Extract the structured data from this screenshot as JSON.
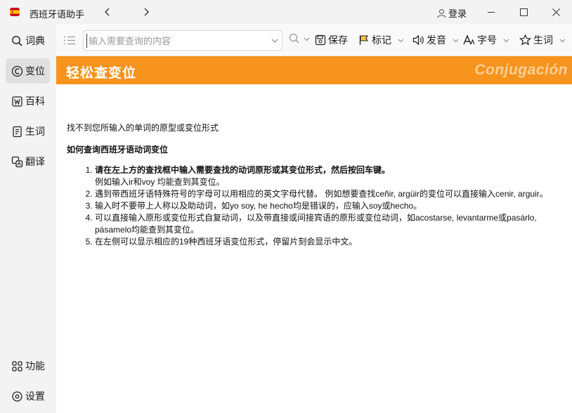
{
  "window": {
    "title": "西班牙语助手",
    "login_label": "登录"
  },
  "sidebar": {
    "items": [
      {
        "label": "词典",
        "icon": "search-icon"
      },
      {
        "label": "变位",
        "icon": "conjugation-icon",
        "active": true
      },
      {
        "label": "百科",
        "icon": "encyclopedia-icon"
      },
      {
        "label": "生词",
        "icon": "notebook-icon"
      },
      {
        "label": "翻译",
        "icon": "translate-icon"
      }
    ],
    "bottom_items": [
      {
        "label": "功能",
        "icon": "grid-icon"
      },
      {
        "label": "设置",
        "icon": "gear-icon"
      }
    ]
  },
  "toolbar": {
    "search_placeholder": "输入需要查询的内容",
    "save_label": "保存",
    "mark_label": "标记",
    "pronounce_label": "发音",
    "fontsize_label": "字号",
    "vocab_label": "生词"
  },
  "banner": {
    "title": "轻松查变位",
    "subtitle": "Conjugación",
    "color": "#f7941d"
  },
  "content": {
    "message": "找不到您所输入的单词的原型或变位形式",
    "howto_title": "如何查询西班牙语动词变位",
    "steps": [
      {
        "bold": "请在左上方的查找框中输入需要查找的动词原形或其变位形式，然后按回车键。",
        "text": "例如输入ir和voy 均能查到其变位。"
      },
      {
        "bold": "",
        "text": "遇到带西班牙语特殊符号的字母可以用相应的英文字母代替。 例如想要查找ceñir, argüir的变位可以直接输入cenir, arguir。"
      },
      {
        "bold": "",
        "text": "输入时不要带上人称以及助动词，如yo soy, he hecho均是错误的，应输入soy或hecho。"
      },
      {
        "bold": "",
        "text": "可以直接输入原形或变位形式自复动词，以及带直接或间接宾语的原形或变位动词，如acostarse, levantarme或pasárlo, pásamelo均能查到其变位。"
      },
      {
        "bold": "",
        "text": "在左侧可以显示相应的19种西班牙语变位形式，停留片刻会显示中文。"
      }
    ]
  }
}
